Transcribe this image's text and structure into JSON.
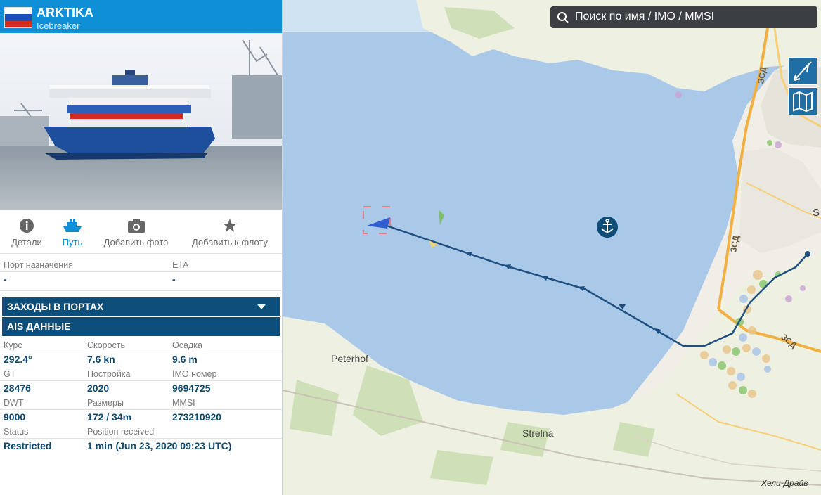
{
  "vessel": {
    "name": "ARKTIKA",
    "type": "Icebreaker",
    "flag": "russia-flag"
  },
  "tabs": [
    {
      "label": "Детали",
      "icon": "info-icon"
    },
    {
      "label": "Путь",
      "icon": "ship-icon",
      "active": true
    },
    {
      "label": "Добавить фото",
      "icon": "camera-icon"
    },
    {
      "label": "Добавить к флоту",
      "icon": "star-icon"
    }
  ],
  "destination": {
    "port_label": "Порт назначения",
    "port_value": "-",
    "eta_label": "ETA",
    "eta_value": "-"
  },
  "sections": {
    "port_calls": "ЗАХОДЫ В ПОРТАХ",
    "ais": "AIS ДАННЫЕ"
  },
  "ais": {
    "course_label": "Курс",
    "course": "292.4°",
    "speed_label": "Скорость",
    "speed": "7.6 kn",
    "draught_label": "Осадка",
    "draught": "9.6 m",
    "gt_label": "GT",
    "gt": "28476",
    "built_label": "Постройка",
    "built": "2020",
    "imo_label": "IMO номер",
    "imo": "9694725",
    "dwt_label": "DWT",
    "dwt": "9000",
    "size_label": "Размеры",
    "size": "172 / 34m",
    "mmsi_label": "MMSI",
    "mmsi": "273210920",
    "status_label": "Status",
    "status": "Restricted",
    "received_label": "Position received",
    "received": "1 min (Jun 23, 2020 09:23 UTC)"
  },
  "search": {
    "placeholder": "Поиск по имя / IMO / MMSI"
  },
  "map": {
    "places": [
      "Peterhof",
      "Strelna",
      "Хели-Драйв",
      "ЗСД",
      "ЗСД",
      "ЗСД",
      "S"
    ],
    "controls": [
      "compass-icon",
      "map-layers-icon"
    ]
  },
  "colors": {
    "header": "#0f8fd6",
    "section_bar": "#0d4f7a",
    "value_text": "#0e4a6e",
    "track": "#1d4f80",
    "water": "#a9c9e8"
  }
}
